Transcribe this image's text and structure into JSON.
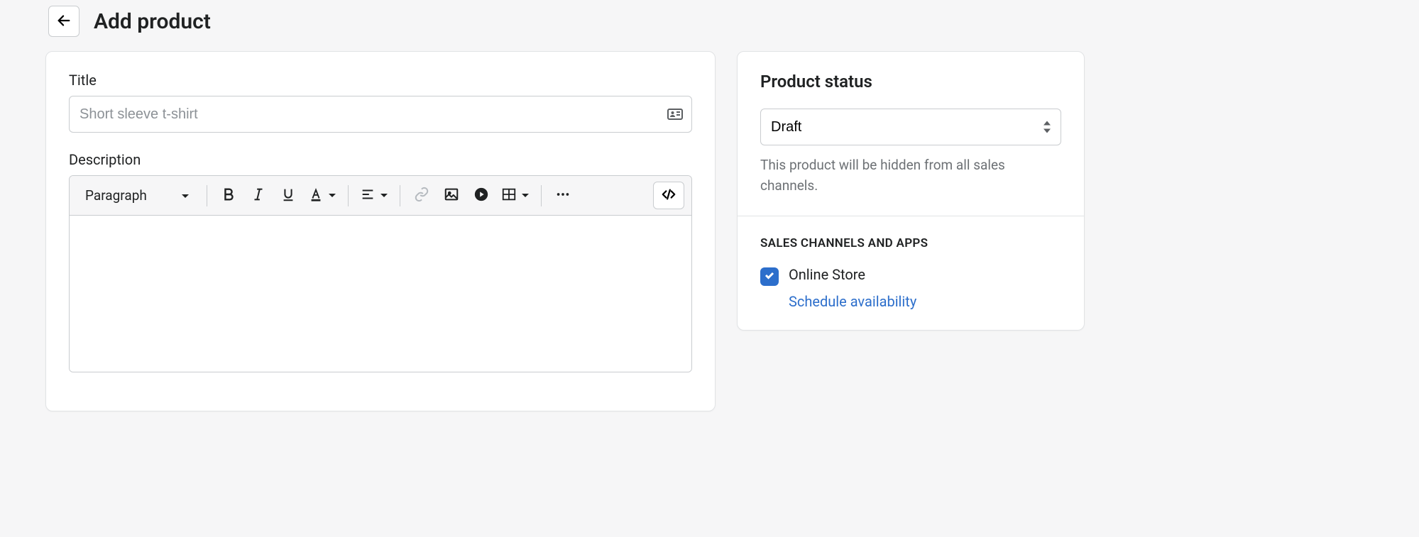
{
  "header": {
    "title": "Add product"
  },
  "main": {
    "title_label": "Title",
    "title_placeholder": "Short sleeve t-shirt",
    "title_value": "",
    "description_label": "Description",
    "rte_format_selected": "Paragraph"
  },
  "side": {
    "status_heading": "Product status",
    "status_selected": "Draft",
    "status_help": "This product will be hidden from all sales channels.",
    "channels_heading": "SALES CHANNELS AND APPS",
    "channel_label": "Online Store",
    "schedule_link": "Schedule availability"
  }
}
